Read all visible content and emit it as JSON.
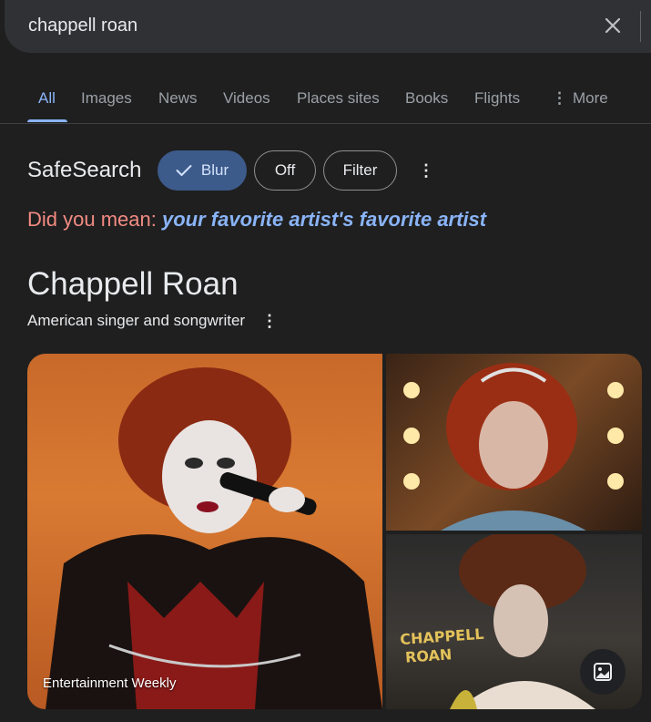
{
  "search": {
    "query": "chappell roan",
    "clear_icon": "close-icon"
  },
  "tabs": [
    {
      "label": "All",
      "active": true
    },
    {
      "label": "Images"
    },
    {
      "label": "News"
    },
    {
      "label": "Videos"
    },
    {
      "label": "Places sites"
    },
    {
      "label": "Books"
    },
    {
      "label": "Flights"
    },
    {
      "label": "More",
      "icon": "vertical-dots-icon"
    }
  ],
  "safesearch": {
    "label": "SafeSearch",
    "options": [
      {
        "label": "Blur",
        "selected": true,
        "icon": "check-icon"
      },
      {
        "label": "Off"
      },
      {
        "label": "Filter"
      }
    ],
    "menu_icon": "vertical-dots-icon"
  },
  "spelling": {
    "prefix": "Did you mean:",
    "suggestion": "your favorite artist's favorite artist"
  },
  "entity": {
    "title": "Chappell Roan",
    "subtitle": "American singer and songwriter"
  },
  "gallery": {
    "main_source": "Entertainment Weekly",
    "poster_text": "CHAPPELL ROAN",
    "image_button_icon": "image-icon"
  },
  "colors": {
    "background": "#1f1f1f",
    "search_bar": "#303134",
    "accent_link": "#8ab4f8",
    "selected_chip": "#3c5a8a",
    "did_you_mean": "#f28b82"
  }
}
